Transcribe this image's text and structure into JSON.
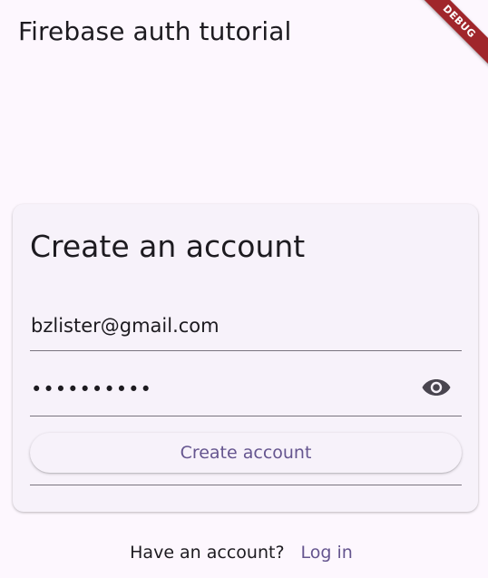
{
  "app_bar": {
    "title": "Firebase auth tutorial",
    "debug_badge": "DEBUG"
  },
  "card": {
    "title": "Create an account",
    "email_field": {
      "value": "bzlister@gmail.com"
    },
    "password_field": {
      "value": "••••••••••",
      "toggle_icon": "eye-icon"
    },
    "create_button_label": "Create account"
  },
  "footer": {
    "prompt": "Have an account?",
    "link_label": "Log in"
  },
  "colors": {
    "background": "#fdf7fe",
    "card": "#f7f2fa",
    "primary": "#65558f",
    "outline": "#79747e",
    "debug": "#a0262b"
  }
}
